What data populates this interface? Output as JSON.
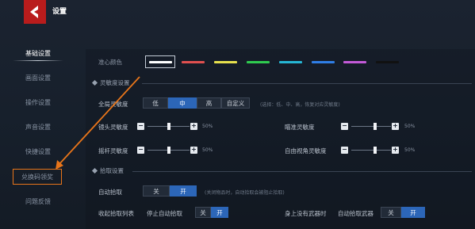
{
  "window": {
    "title": "设置"
  },
  "sidebar": {
    "items": [
      {
        "label": "基础设置"
      },
      {
        "label": "画面设置"
      },
      {
        "label": "操作设置"
      },
      {
        "label": "声音设置"
      },
      {
        "label": "快捷设置"
      },
      {
        "label": "兑换码领奖"
      },
      {
        "label": "问题反馈"
      }
    ],
    "active_index": 0,
    "highlighted_index": 5
  },
  "crosshair": {
    "label": "准心颜色",
    "colors": [
      "#ffffff",
      "#e0504f",
      "#e7e04d",
      "#2fcb4f",
      "#26b6d4",
      "#2f7ee6",
      "#c35ad8",
      "#111111"
    ],
    "selected_index": 0
  },
  "sensitivity": {
    "section_title": "灵敏度设置",
    "global": {
      "label": "全局灵敏度",
      "options": [
        "低",
        "中",
        "高",
        "自定义"
      ],
      "selected_index": 1,
      "hint": "(选择：低、中、高，恢复对应灵敏度)"
    },
    "sliders": [
      {
        "label": "镜头灵敏度",
        "value": "50%",
        "level": 0.5,
        "minus": "−",
        "plus": "+"
      },
      {
        "label": "瞄准灵敏度",
        "value": "50%",
        "level": 0.5,
        "minus": "−",
        "plus": "+"
      },
      {
        "label": "摇杆灵敏度",
        "value": "50%",
        "level": 0.5,
        "minus": "−",
        "plus": "+"
      },
      {
        "label": "自由视角灵敏度",
        "value": "50%",
        "level": 0.5,
        "minus": "−",
        "plus": "+"
      }
    ]
  },
  "pickup": {
    "section_title": "拾取设置",
    "auto": {
      "label": "自动拾取",
      "options": [
        "关",
        "开"
      ],
      "selected_index": 1,
      "hint": "(关闭物品时，自动拾取会被阻止拾取)"
    },
    "partial": [
      {
        "label": "收起拾取列表",
        "sub_label": "停止自动拾取",
        "options": [
          "关",
          "开"
        ],
        "selected_index": 1
      },
      {
        "label": "身上没有武器时",
        "sub_label": "自动拾取武器",
        "options": [
          "关",
          "开"
        ],
        "selected_index": 1
      }
    ]
  },
  "colors": {
    "accent": "#2c66b8",
    "highlight_orange": "#e8751a",
    "logo_red": "#b91c1c"
  }
}
